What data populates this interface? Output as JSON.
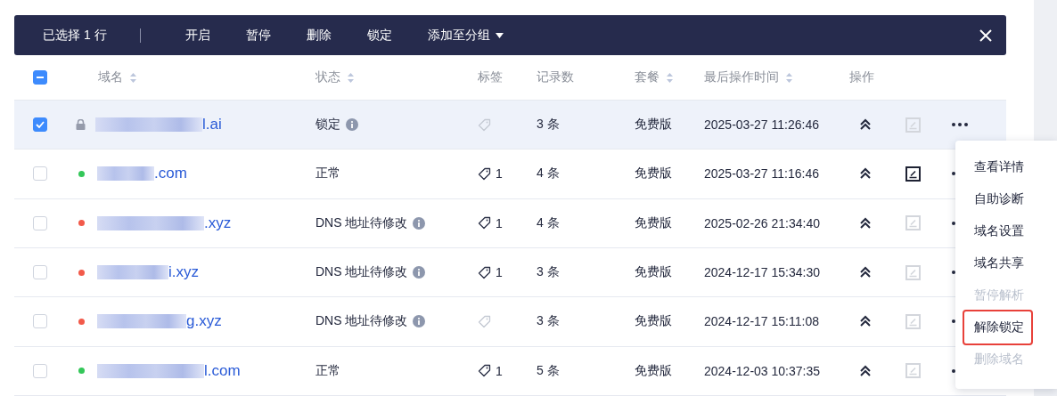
{
  "toolbar": {
    "selection": "已选择 1 行",
    "actions": [
      "开启",
      "暂停",
      "删除",
      "锁定"
    ],
    "group_dropdown": "添加至分组"
  },
  "table": {
    "select_all_partial": true,
    "columns": [
      {
        "label": "域名",
        "sortable": true
      },
      {
        "label": "状态",
        "sortable": true
      },
      {
        "label": "标签",
        "sortable": false
      },
      {
        "label": "记录数",
        "sortable": false
      },
      {
        "label": "套餐",
        "sortable": true
      },
      {
        "label": "最后操作时间",
        "sortable": true
      },
      {
        "label": "操作",
        "sortable": false
      }
    ],
    "rows": [
      {
        "selected": true,
        "locked": true,
        "domain": "l.ai",
        "status": "锁定",
        "status_info": true,
        "records": "3 条",
        "plan": "免费版",
        "time": "2025-03-27 11:26:46",
        "edit_enabled": false
      },
      {
        "selected": false,
        "locked": false,
        "color": "#34c759",
        "domain": ".com",
        "status": "正常",
        "status_info": false,
        "tag_count": "1",
        "records": "4 条",
        "plan": "免费版",
        "time": "2025-03-27 11:16:46",
        "edit_enabled": true
      },
      {
        "selected": false,
        "locked": false,
        "color": "#f25a4a",
        "domain": ".xyz",
        "status": "DNS 地址待修改",
        "status_info": true,
        "tag_count": "1",
        "records": "4 条",
        "plan": "免费版",
        "time": "2025-02-26 21:34:40",
        "edit_enabled": false
      },
      {
        "selected": false,
        "locked": false,
        "color": "#f25a4a",
        "domain": "i.xyz",
        "status": "DNS 地址待修改",
        "status_info": true,
        "tag_count": "1",
        "records": "3 条",
        "plan": "免费版",
        "time": "2024-12-17 15:34:30",
        "edit_enabled": false
      },
      {
        "selected": false,
        "locked": false,
        "color": "#f25a4a",
        "domain": "g.xyz",
        "status": "DNS 地址待修改",
        "status_info": true,
        "records": "3 条",
        "plan": "免费版",
        "time": "2024-12-17 15:11:08",
        "edit_enabled": false
      },
      {
        "selected": false,
        "locked": false,
        "color": "#34c759",
        "domain": "l.com",
        "status": "正常",
        "status_info": false,
        "tag_count": "1",
        "records": "5 条",
        "plan": "免费版",
        "time": "2024-12-03 10:37:35",
        "edit_enabled": false
      }
    ]
  },
  "menu": {
    "items": [
      {
        "label": "查看详情",
        "disabled": false,
        "marked": false
      },
      {
        "label": "自助诊断",
        "disabled": false,
        "marked": false
      },
      {
        "label": "域名设置",
        "disabled": false,
        "marked": false
      },
      {
        "label": "域名共享",
        "disabled": false,
        "marked": false
      },
      {
        "label": "暂停解析",
        "disabled": true,
        "marked": false
      },
      {
        "label": "解除锁定",
        "disabled": false,
        "marked": true
      },
      {
        "label": "删除域名",
        "disabled": true,
        "marked": false
      }
    ]
  }
}
